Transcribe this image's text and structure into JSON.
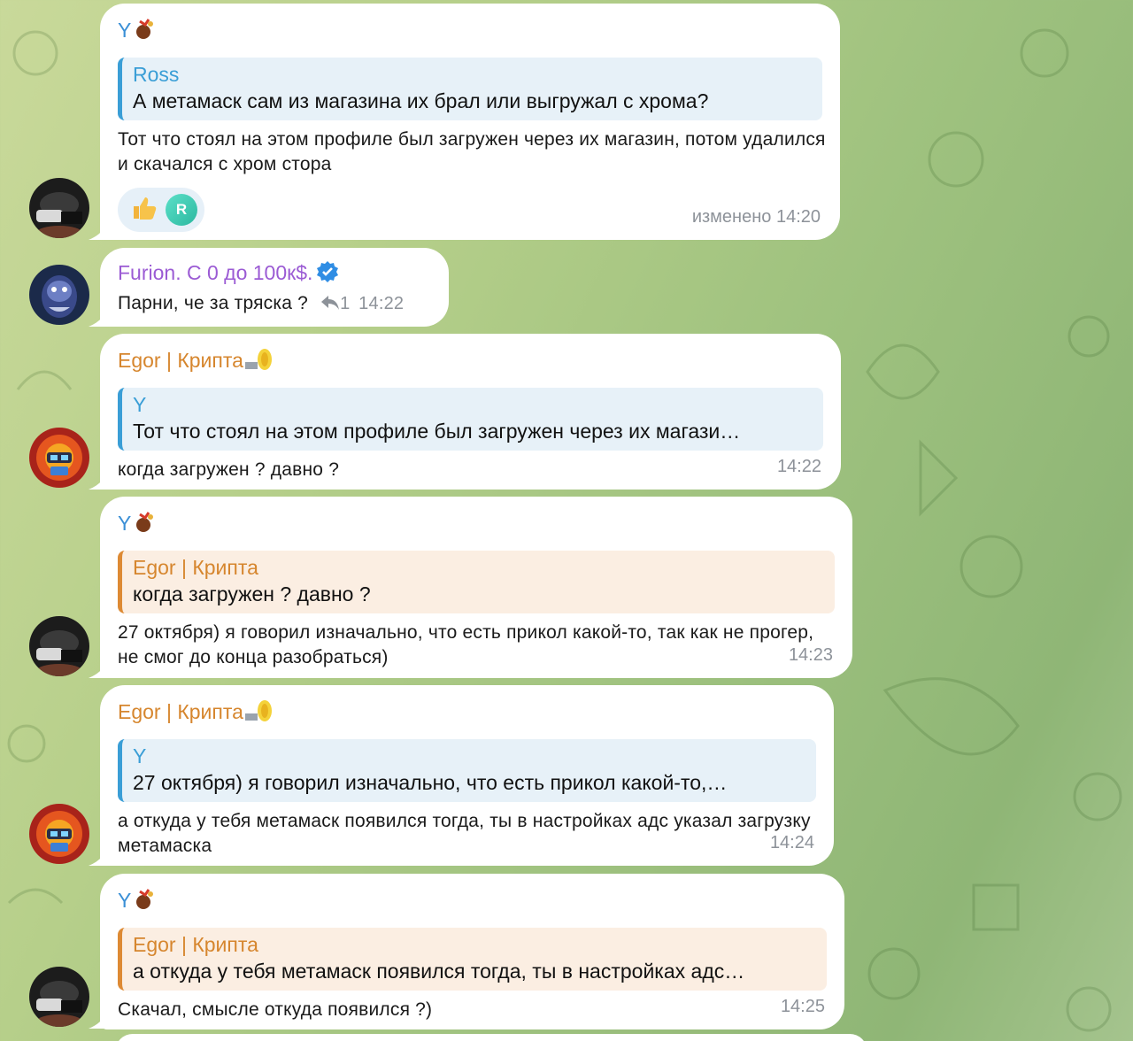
{
  "colors": {
    "bubble": "#ffffff",
    "name_blue": "#3a8fd6",
    "name_orange": "#d6862e",
    "name_purple": "#9b5bd4",
    "timestamp": "#8d9299"
  },
  "messages": [
    {
      "sender": "Y",
      "quote_name": "Ross",
      "quote_text": "А метамаск сам из магазина их брал или выгружал с хрома?",
      "text": "Тот что стоял на этом профиле был загружен через их магазин, потом удалился и скачался с хром стора",
      "reactions": [
        "thumbs-up-icon",
        "R"
      ],
      "time": "изменено 14:20"
    },
    {
      "sender": "Furion. С 0 до 100к$.",
      "text": "Парни, че за тряска ?",
      "reply_count": "1",
      "time": "14:22"
    },
    {
      "sender": "Egor | Крипта",
      "quote_name": "Y",
      "quote_text": "Тот что стоял на этом профиле был загружен через их магази…",
      "text": "когда загружен ? давно ?",
      "time": "14:22"
    },
    {
      "sender": "Y",
      "quote_name": "Egor | Крипта",
      "quote_text": "когда загружен ? давно ?",
      "text": "27 октября) я говорил изначально, что есть прикол какой-то, так как не прогер, не смог до конца разобраться)",
      "time": "14:23"
    },
    {
      "sender": "Egor | Крипта",
      "quote_name": "Y",
      "quote_text": "27 октября) я говорил изначально, что есть прикол какой-то,…",
      "text": "а откуда у тебя метамаск появился тогда, ты в настройках адс указал загрузку метамаска",
      "time": "14:24"
    },
    {
      "sender": "Y",
      "quote_name": "Egor | Крипта",
      "quote_text": "а откуда у тебя метамаск появился тогда, ты в настройках адс…",
      "text": "Скачал, смысле откуда появился ?)",
      "time": "14:25"
    }
  ]
}
